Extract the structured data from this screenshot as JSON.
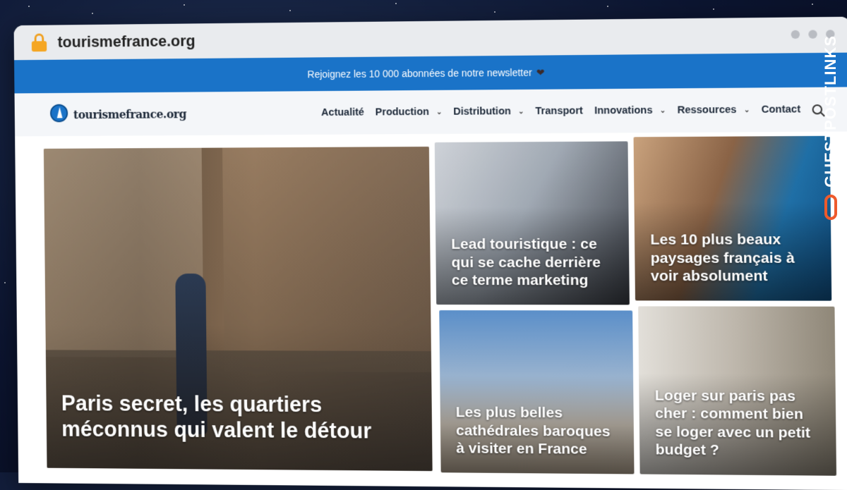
{
  "browser": {
    "url": "tourismefrance.org"
  },
  "newsletter": {
    "text": "Rejoignez les 10 000 abonnées de notre newsletter",
    "heart": "❤"
  },
  "site": {
    "logo_text": "tourismefrance.org"
  },
  "nav": {
    "items": [
      {
        "label": "Actualité",
        "dropdown": false
      },
      {
        "label": "Production",
        "dropdown": true
      },
      {
        "label": "Distribution",
        "dropdown": true
      },
      {
        "label": "Transport",
        "dropdown": false
      },
      {
        "label": "Innovations",
        "dropdown": true
      },
      {
        "label": "Ressources",
        "dropdown": true
      },
      {
        "label": "Contact",
        "dropdown": false
      }
    ],
    "chevron": "⌄"
  },
  "articles": [
    {
      "title": "Paris secret, les quartiers méconnus qui valent le détour"
    },
    {
      "title": "Lead touristique : ce qui se cache derrière ce terme marketing"
    },
    {
      "title": "Les 10 plus beaux paysages français à voir absolument"
    },
    {
      "title": "Les plus belles cathédrales baroques à visiter en France"
    },
    {
      "title": "Loger sur paris pas cher : comment bien se loger avec un petit budget ?"
    }
  ],
  "watermark": {
    "text": "GUESTPOSTLINKS"
  }
}
